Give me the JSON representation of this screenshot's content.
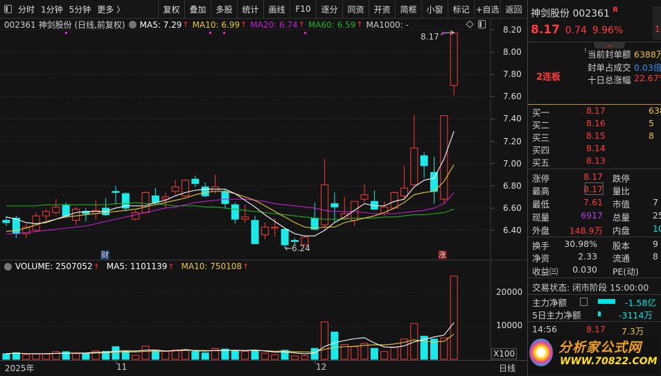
{
  "toolbar": {
    "left_items": [
      "分时",
      "1分钟",
      "5分钟",
      "更多 〉"
    ],
    "buttons": [
      "复权",
      "叠加",
      "多股",
      "统计",
      "画线",
      "F10",
      "逐分",
      "同资",
      "开资",
      "简框",
      "小窗",
      "标记",
      "+自选",
      "返回"
    ]
  },
  "info": {
    "title": "002361 神剑股份 (日线,前复权)",
    "ma5": "MA5: 7.29",
    "ma10": "MA10: 6.99",
    "ma20": "MA20: 6.74",
    "ma60": "MA60: 6.59",
    "ma1000": "MA1000: -",
    "up_arrow": "↑"
  },
  "volume_info": {
    "volume": "VOLUME: 2507052",
    "ma5": "MA5: 1101139",
    "ma10": "MA10: 750108"
  },
  "markers": {
    "high_label": "8.17",
    "low_label": "←6.24",
    "cai": "财",
    "zhang": "涨"
  },
  "date_axis": {
    "labels": [
      "2025年",
      "11",
      "12"
    ],
    "period": "日线"
  },
  "colors": {
    "up": "#ff3b3b",
    "down": "#1ee8e8",
    "ma5": "#ffffff",
    "ma10": "#e8c83a",
    "ma20": "#c020d0",
    "ma60": "#20b020",
    "bg": "#141414"
  },
  "chart_data": {
    "type": "candlestick",
    "price_ticks": [
      "8.20",
      "8.00",
      "7.80",
      "7.60",
      "7.40",
      "7.20",
      "7.00",
      "6.80",
      "6.60",
      "6.40"
    ],
    "ylim": [
      6.4,
      8.2
    ],
    "candles": [
      [
        6.49,
        6.53,
        6.44,
        6.47
      ],
      [
        6.51,
        6.53,
        6.33,
        6.37
      ],
      [
        6.37,
        6.46,
        6.33,
        6.43
      ],
      [
        6.4,
        6.56,
        6.39,
        6.53
      ],
      [
        6.53,
        6.59,
        6.49,
        6.57
      ],
      [
        6.56,
        6.68,
        6.54,
        6.61
      ],
      [
        6.63,
        6.65,
        6.51,
        6.53
      ],
      [
        6.49,
        6.61,
        6.45,
        6.59
      ],
      [
        6.57,
        6.6,
        6.48,
        6.55
      ],
      [
        6.55,
        6.67,
        6.5,
        6.58
      ],
      [
        6.6,
        6.69,
        6.53,
        6.54
      ],
      [
        6.75,
        6.8,
        6.63,
        6.74
      ],
      [
        6.73,
        6.74,
        6.57,
        6.6
      ],
      [
        6.5,
        6.58,
        6.49,
        6.56
      ],
      [
        6.56,
        6.75,
        6.55,
        6.74
      ],
      [
        6.71,
        6.78,
        6.63,
        6.65
      ],
      [
        6.68,
        6.74,
        6.6,
        6.7
      ],
      [
        6.75,
        6.85,
        6.72,
        6.79
      ],
      [
        6.71,
        6.86,
        6.7,
        6.85
      ],
      [
        6.86,
        6.89,
        6.79,
        6.82
      ],
      [
        6.79,
        6.83,
        6.7,
        6.71
      ],
      [
        6.75,
        6.9,
        6.73,
        6.79
      ],
      [
        6.75,
        6.77,
        6.6,
        6.64
      ],
      [
        6.63,
        6.65,
        6.46,
        6.5
      ],
      [
        6.5,
        6.63,
        6.47,
        6.52
      ],
      [
        6.49,
        6.53,
        6.28,
        6.28
      ],
      [
        6.36,
        6.47,
        6.32,
        6.43
      ],
      [
        6.42,
        6.51,
        6.34,
        6.43
      ],
      [
        6.41,
        6.42,
        6.24,
        6.27
      ],
      [
        6.31,
        6.33,
        6.27,
        6.3
      ],
      [
        6.27,
        6.35,
        6.27,
        6.34
      ],
      [
        6.51,
        6.65,
        6.4,
        6.41
      ],
      [
        6.45,
        7.04,
        6.4,
        6.81
      ],
      [
        6.64,
        6.74,
        6.47,
        6.61
      ],
      [
        6.51,
        6.7,
        6.5,
        6.55
      ],
      [
        6.49,
        6.66,
        6.44,
        6.66
      ],
      [
        6.68,
        6.81,
        6.65,
        6.72
      ],
      [
        6.66,
        6.76,
        6.58,
        6.59
      ],
      [
        6.55,
        6.66,
        6.53,
        6.61
      ],
      [
        6.6,
        6.75,
        6.59,
        6.74
      ],
      [
        6.71,
        6.98,
        6.68,
        6.78
      ],
      [
        6.81,
        7.44,
        6.8,
        7.14
      ],
      [
        7.07,
        7.1,
        6.87,
        6.98
      ],
      [
        6.92,
        7.06,
        6.64,
        6.75
      ],
      [
        6.68,
        7.43,
        6.64,
        7.43
      ],
      [
        7.7,
        8.17,
        7.61,
        8.17
      ]
    ],
    "candle_format": [
      "open",
      "high",
      "low",
      "close"
    ],
    "ma5": [
      6.52,
      6.5,
      6.47,
      6.46,
      6.47,
      6.5,
      6.53,
      6.56,
      6.57,
      6.57,
      6.57,
      6.6,
      6.62,
      6.62,
      6.62,
      6.65,
      6.67,
      6.71,
      6.74,
      6.76,
      6.77,
      6.77,
      6.77,
      6.73,
      6.67,
      6.61,
      6.54,
      6.48,
      6.42,
      6.37,
      6.35,
      6.35,
      6.4,
      6.47,
      6.52,
      6.58,
      6.64,
      6.62,
      6.62,
      6.66,
      6.68,
      6.79,
      6.85,
      6.87,
      7.04,
      7.29
    ],
    "ma10": [
      6.39,
      6.4,
      6.42,
      6.45,
      6.48,
      6.5,
      6.52,
      6.53,
      6.54,
      6.55,
      6.56,
      6.57,
      6.58,
      6.59,
      6.61,
      6.63,
      6.65,
      6.67,
      6.69,
      6.72,
      6.74,
      6.75,
      6.75,
      6.73,
      6.7,
      6.67,
      6.62,
      6.57,
      6.52,
      6.47,
      6.43,
      6.42,
      6.43,
      6.43,
      6.47,
      6.49,
      6.51,
      6.53,
      6.56,
      6.6,
      6.65,
      6.72,
      6.74,
      6.75,
      6.84,
      6.99
    ],
    "ma20": [
      6.37,
      6.37,
      6.38,
      6.39,
      6.4,
      6.41,
      6.42,
      6.43,
      6.44,
      6.46,
      6.48,
      6.5,
      6.52,
      6.54,
      6.56,
      6.58,
      6.6,
      6.61,
      6.63,
      6.65,
      6.66,
      6.67,
      6.68,
      6.68,
      6.68,
      6.67,
      6.66,
      6.64,
      6.63,
      6.62,
      6.61,
      6.6,
      6.58,
      6.57,
      6.57,
      6.57,
      6.56,
      6.55,
      6.55,
      6.55,
      6.56,
      6.57,
      6.58,
      6.6,
      6.64,
      6.74
    ],
    "ma60": [
      6.62,
      6.62,
      6.62,
      6.62,
      6.63,
      6.63,
      6.63,
      6.63,
      6.63,
      6.63,
      6.63,
      6.64,
      6.64,
      6.65,
      6.64,
      6.64,
      6.63,
      6.62,
      6.62,
      6.62,
      6.61,
      6.61,
      6.6,
      6.59,
      6.58,
      6.57,
      6.56,
      6.55,
      6.54,
      6.53,
      6.52,
      6.51,
      6.5,
      6.5,
      6.5,
      6.51,
      6.51,
      6.51,
      6.52,
      6.52,
      6.53,
      6.54,
      6.54,
      6.55,
      6.56,
      6.59
    ],
    "volume_ticks": [
      "20000",
      "10000"
    ],
    "volume_unit": "X100",
    "volumes": [
      1700,
      2000,
      1450,
      1600,
      1600,
      2300,
      2300,
      1700,
      1700,
      2550,
      2400,
      3800,
      2400,
      1250,
      3950,
      2550,
      2400,
      2850,
      2850,
      2400,
      1950,
      3250,
      3100,
      2550,
      2400,
      2700,
      1850,
      1400,
      2750,
      1050,
      1050,
      3300,
      11250,
      8200,
      4450,
      3800,
      4800,
      3300,
      2350,
      3700,
      6100,
      10800,
      6950,
      6100,
      6450,
      25000
    ],
    "volume_up": [
      false,
      false,
      true,
      true,
      true,
      true,
      false,
      true,
      false,
      true,
      false,
      false,
      false,
      true,
      true,
      false,
      true,
      true,
      true,
      false,
      false,
      true,
      false,
      false,
      true,
      false,
      true,
      true,
      false,
      true,
      true,
      false,
      true,
      false,
      true,
      true,
      true,
      false,
      true,
      true,
      true,
      true,
      false,
      false,
      true,
      true
    ]
  },
  "quote": {
    "name_code": "神剑股份 002361",
    "r_tag": "R",
    "price": "8.17",
    "change": "0.74",
    "pct": "9.96%",
    "side_fragment": "1",
    "seal_amount_label": "当前封单额",
    "seal_amount": "6388万",
    "seal_ratio_label": "封单占成交",
    "seal_ratio": "0.03倍",
    "ten_day_label": "十日总涨幅",
    "ten_day": "22.67%",
    "streak": "2连板"
  },
  "bids": [
    {
      "label": "买一",
      "price": "8.17",
      "vol": "638"
    },
    {
      "label": "买二",
      "price": "8.16",
      "vol": "5"
    },
    {
      "label": "买三",
      "price": "8.15",
      "vol": "8"
    },
    {
      "label": "买四",
      "price": "8.14",
      "vol": ""
    },
    {
      "label": "买五",
      "price": "8.13",
      "vol": ""
    }
  ],
  "stats": {
    "limit_up_l": "涨停",
    "limit_up": "8.17",
    "limit_down_l": "跌停",
    "high_l": "最高",
    "high": "8.17",
    "vol_ratio_l": "量比",
    "low_l": "最低",
    "low": "7.61",
    "mcap_l": "市值",
    "mcap": "7",
    "cur_vol_l": "现量",
    "cur_vol": "6917",
    "total_vol_l": "总量",
    "total_vol": "25",
    "outer_l": "外盘",
    "outer": "148.9万",
    "inner_l": "内盘",
    "inner": "10",
    "turnover_l": "换手",
    "turnover": "30.98%",
    "share_cap_l": "股本",
    "share_cap": "9",
    "nav_l": "净资",
    "nav": "2.33",
    "float_l": "流通",
    "float": "8",
    "eps_l": "收益㈢",
    "eps": "0.030",
    "pe_l": "PE(动)"
  },
  "status": {
    "text": "交易状态: 闭市阶段 15:00:00"
  },
  "flows": [
    {
      "label": "主力净额",
      "value": "-1.58亿",
      "fill": 0.5
    },
    {
      "label": "5日主力净额",
      "value": "-3114万",
      "fill": 0.1
    }
  ],
  "tick": {
    "time": "14:56",
    "price": "8.17",
    "vol": "7.3万"
  },
  "watermark": {
    "name": "分析家公式网",
    "url": "WWW.70822.COM"
  }
}
